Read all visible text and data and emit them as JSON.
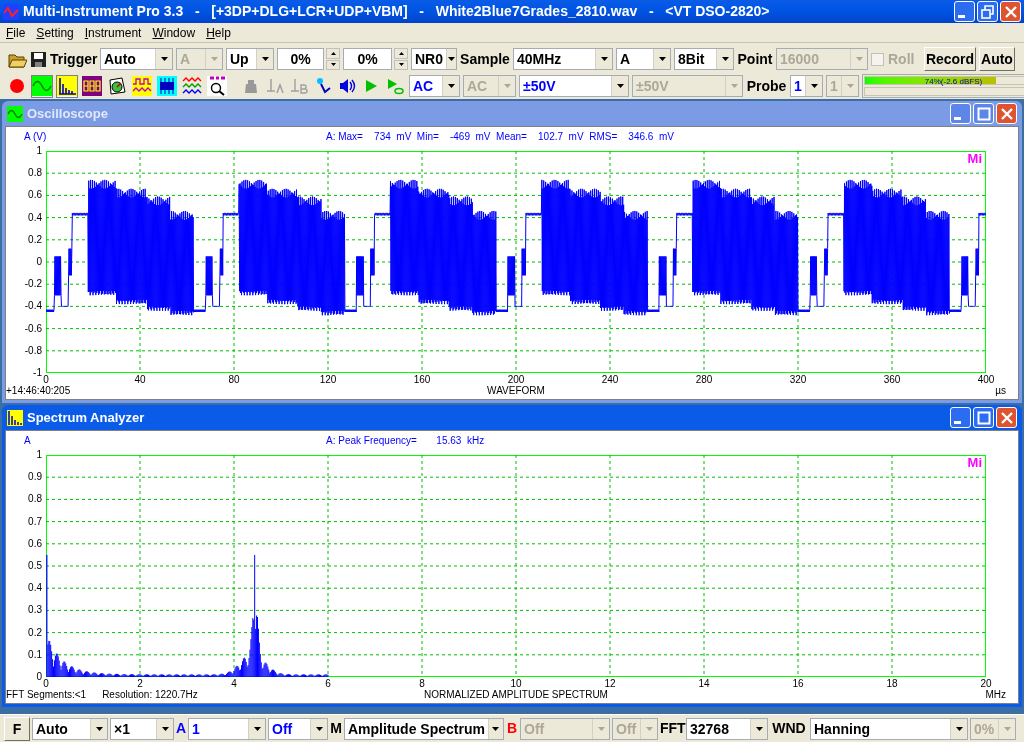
{
  "window": {
    "title": "Multi-Instrument Pro 3.3   -   [+3DP+DLG+LCR+UDP+VBM]   -   White2Blue7Grades_2810.wav   -   <VT DSO-2820>"
  },
  "menu": [
    {
      "label": "File"
    },
    {
      "label": "Setting"
    },
    {
      "label": "Instrument"
    },
    {
      "label": "Window"
    },
    {
      "label": "Help"
    }
  ],
  "toolbar": {
    "row1": [
      {
        "kind": "label",
        "text": "Trigger"
      },
      {
        "kind": "combo",
        "value": "Auto",
        "disabled": false
      },
      {
        "kind": "combo",
        "value": "A",
        "disabled": true
      },
      {
        "kind": "combo",
        "value": "Up",
        "disabled": false
      },
      {
        "kind": "spin",
        "value": "0%"
      },
      {
        "kind": "spin",
        "value": "0%"
      },
      {
        "kind": "combo",
        "value": "NR0",
        "disabled": false
      },
      {
        "kind": "label",
        "text": "Sample"
      },
      {
        "kind": "combo",
        "value": "40MHz",
        "disabled": false
      },
      {
        "kind": "combo",
        "value": "A",
        "disabled": false
      },
      {
        "kind": "combo",
        "value": "8Bit",
        "disabled": false
      },
      {
        "kind": "label",
        "text": "Point"
      },
      {
        "kind": "combo",
        "value": "16000",
        "disabled": true
      },
      {
        "kind": "checkbox",
        "label": "Roll",
        "checked": false,
        "disabled": true
      },
      {
        "kind": "button",
        "label": "Record"
      },
      {
        "kind": "button",
        "label": "Auto"
      }
    ],
    "instrument_buttons": [
      {
        "selected": false
      },
      {
        "selected": true
      },
      {
        "selected": true
      },
      {
        "selected": false
      },
      {
        "selected": false
      },
      {
        "selected": false
      },
      {
        "selected": false
      },
      {
        "selected": false
      },
      {
        "selected": false
      }
    ],
    "row2": [
      {
        "kind": "combo",
        "value": "AC",
        "disabled": false,
        "color": "#0000ff"
      },
      {
        "kind": "combo",
        "value": "AC",
        "disabled": true
      },
      {
        "kind": "combo",
        "value": "±50V",
        "disabled": false,
        "color": "#0000ff"
      },
      {
        "kind": "combo",
        "value": "±50V",
        "disabled": true
      },
      {
        "kind": "label",
        "text": "Probe"
      },
      {
        "kind": "combo",
        "value": "1",
        "disabled": false,
        "color": "#0000ff"
      },
      {
        "kind": "combo",
        "value": "1",
        "disabled": true
      },
      {
        "kind": "meter",
        "bars": [
          {
            "level": 0.74,
            "reading": "74%(-2.6 dBFS)"
          }
        ]
      }
    ]
  },
  "oscilloscope": {
    "title": "Oscilloscope",
    "active": false,
    "channel_label": "A (V)",
    "stats": "A: Max=    734  mV  Min=    -469  mV  Mean=    102.7  mV  RMS=    346.6  mV",
    "logo": "Mi",
    "y_ticks": [
      "1",
      "0.8",
      "0.6",
      "0.4",
      "0.2",
      "0",
      "-0.2",
      "-0.4",
      "-0.6",
      "-0.8",
      "-1"
    ],
    "x_ticks": [
      "0",
      "40",
      "80",
      "120",
      "160",
      "200",
      "240",
      "280",
      "320",
      "360",
      "400"
    ],
    "footer_left": [
      "+14:46:40:205"
    ],
    "x_title": "WAVEFORM",
    "x_unit": "µs"
  },
  "spectrum": {
    "title": "Spectrum Analyzer",
    "active": true,
    "channel_label": "A",
    "stats": "A: Peak Frequency=       15.63  kHz",
    "logo": "Mi",
    "y_ticks": [
      "1",
      "0.9",
      "0.8",
      "0.7",
      "0.6",
      "0.5",
      "0.4",
      "0.3",
      "0.2",
      "0.1",
      "0"
    ],
    "x_ticks": [
      "0",
      "2",
      "4",
      "6",
      "8",
      "10",
      "12",
      "14",
      "16",
      "18",
      "20"
    ],
    "footer_left": [
      "FFT Segments:<1",
      "Resolution: 1220.7Hz"
    ],
    "x_title": "NORMALIZED AMPLITUDE SPECTRUM",
    "x_unit": "MHz"
  },
  "bottom_bar": [
    {
      "kind": "button",
      "label": "F"
    },
    {
      "kind": "combo",
      "value": "Auto",
      "disabled": false
    },
    {
      "kind": "combo",
      "value": "×1",
      "disabled": false
    },
    {
      "kind": "label",
      "text": "A",
      "color": "#0000ff"
    },
    {
      "kind": "combo",
      "value": "1",
      "disabled": false,
      "color": "#0000ff"
    },
    {
      "kind": "combo",
      "value": "Off",
      "disabled": false,
      "color": "#0000ff"
    },
    {
      "kind": "label",
      "text": "M"
    },
    {
      "kind": "combo",
      "value": "Amplitude Spectrum",
      "disabled": false
    },
    {
      "kind": "label",
      "text": "B",
      "color": "#ff0000"
    },
    {
      "kind": "combo",
      "value": "Off",
      "disabled": true
    },
    {
      "kind": "combo",
      "value": "Off",
      "disabled": true
    },
    {
      "kind": "label",
      "text": "FFT"
    },
    {
      "kind": "combo",
      "value": "32768",
      "disabled": false
    },
    {
      "kind": "label",
      "text": "WND"
    },
    {
      "kind": "combo",
      "value": "Hanning",
      "disabled": false
    },
    {
      "kind": "combo",
      "value": "0%",
      "disabled": true
    }
  ]
}
